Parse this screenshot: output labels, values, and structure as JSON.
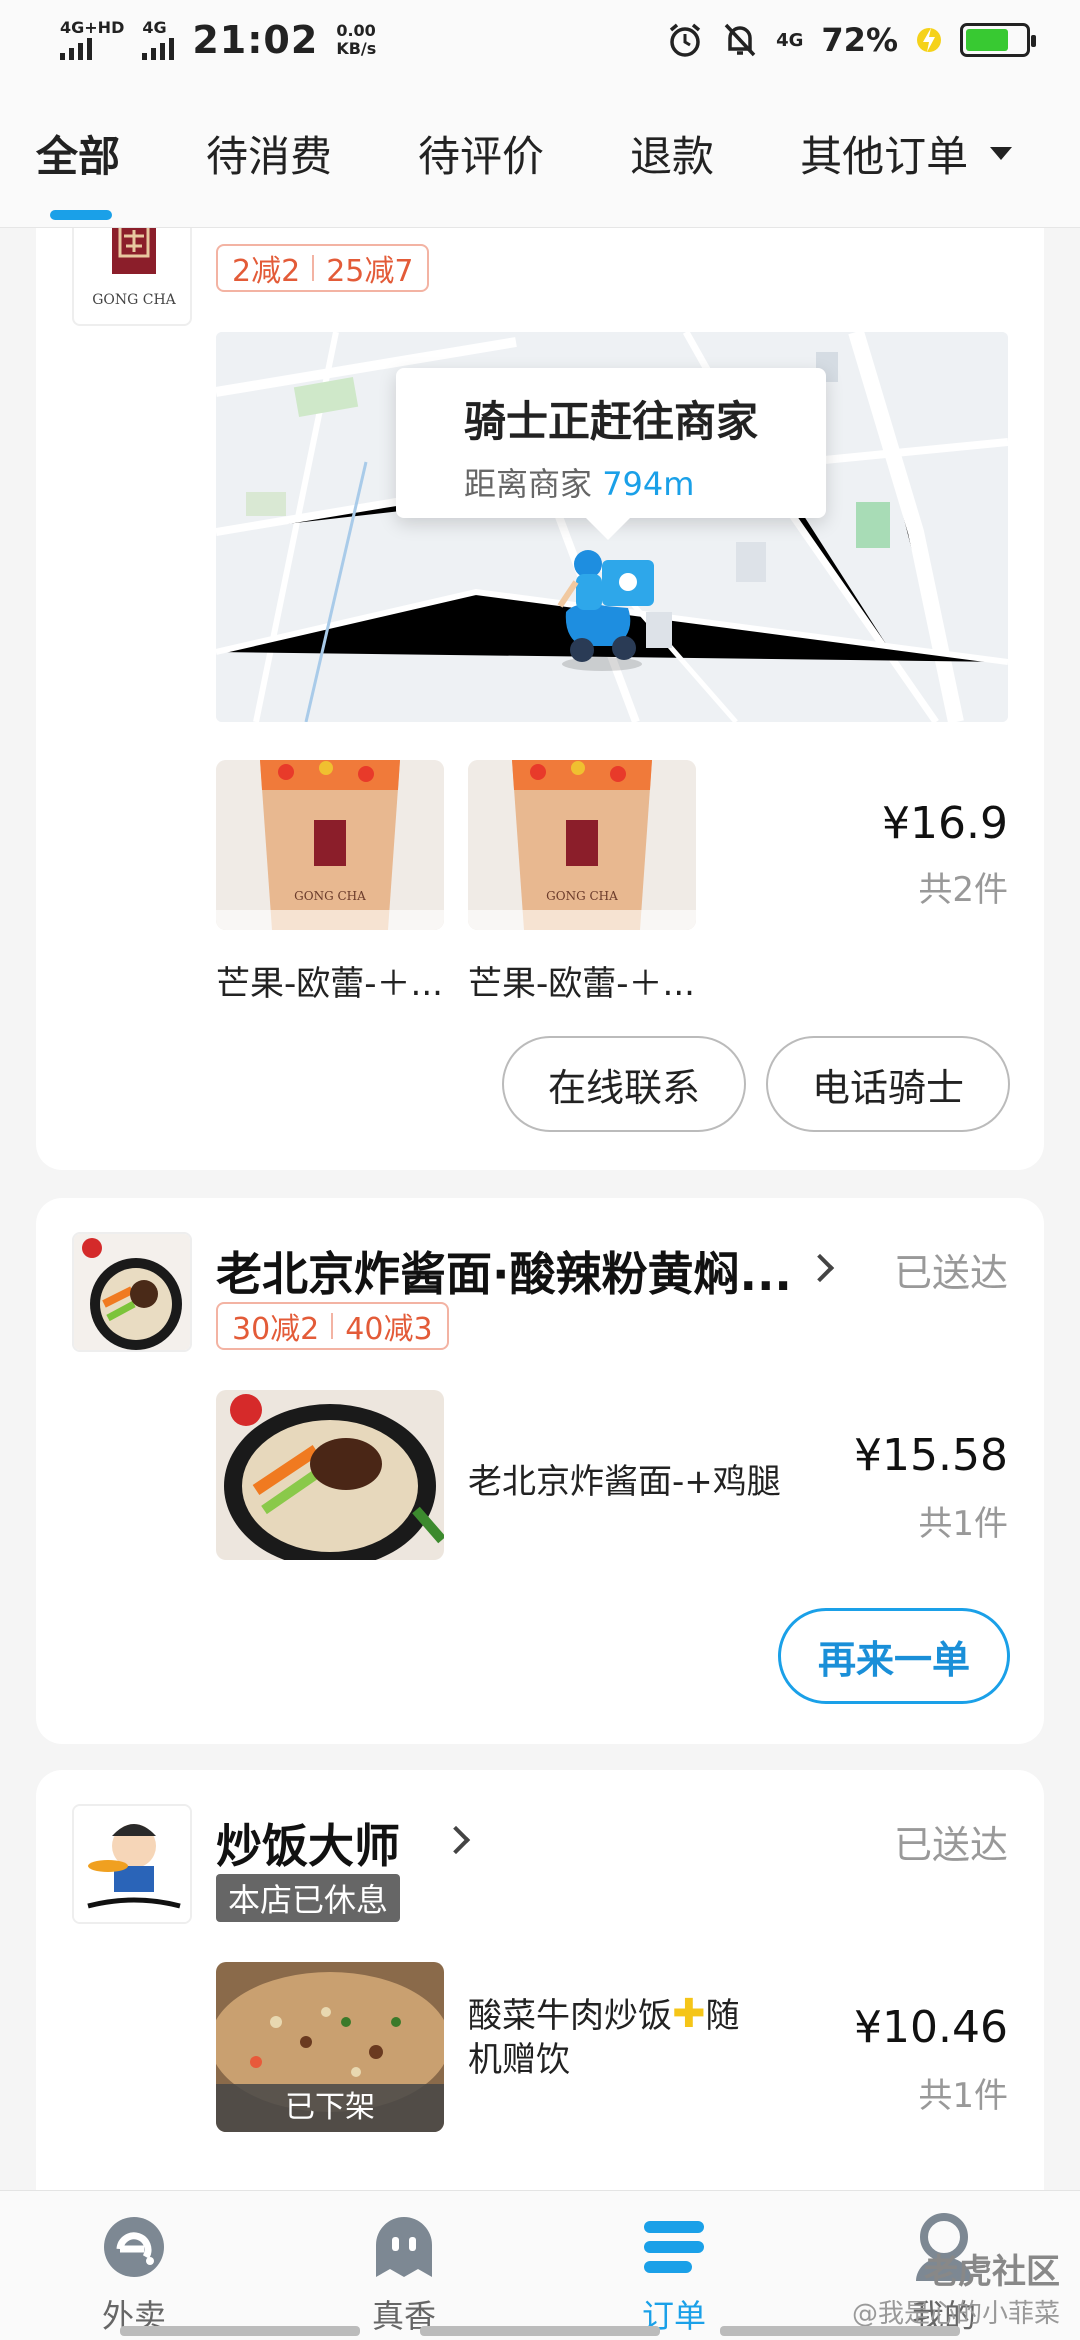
{
  "status_bar": {
    "network1": "4G+HD",
    "network2": "4G",
    "time": "21:02",
    "speed_value": "0.00",
    "speed_unit": "KB/s",
    "network3": "4G",
    "battery": "72%",
    "battery_level": 0.72
  },
  "tabs": [
    {
      "label": "全部",
      "active": true
    },
    {
      "label": "待消费"
    },
    {
      "label": "待评价"
    },
    {
      "label": "退款"
    },
    {
      "label": "其他订单"
    }
  ],
  "order1": {
    "logo_text": "GONG CHA",
    "promos": [
      "2减2",
      "25减7"
    ],
    "map": {
      "title": "骑士正赶往商家",
      "distance_label": "距离商家",
      "distance_value": "794m"
    },
    "items": [
      "芒果-欧蕾-＋...",
      "芒果-欧蕾-＋..."
    ],
    "thumb_label": "GONG CHA",
    "price": "¥16.9",
    "count": "共2件",
    "buttons": [
      "在线联系",
      "电话骑士"
    ]
  },
  "order2": {
    "shop_name": "老北京炸酱面·酸辣粉黄焖...",
    "status": "已送达",
    "promos": [
      "30减2",
      "40减3"
    ],
    "item_name": "老北京炸酱面-+鸡腿",
    "price": "¥15.58",
    "count": "共1件",
    "button": "再来一单"
  },
  "order3": {
    "shop_name": "炒饭大师",
    "status": "已送达",
    "badge": "本店已休息",
    "item_name_line1": "酸菜牛肉炒饭",
    "item_name_line2": "机赠饮",
    "item_name_tail": "随",
    "off_shelf": "已下架",
    "price": "¥10.46",
    "count": "共1件"
  },
  "bottom_nav": [
    {
      "label": "外卖",
      "icon": "eleme-icon"
    },
    {
      "label": "真香",
      "icon": "ghost-icon"
    },
    {
      "label": "订单",
      "icon": "order-list-icon",
      "active": true
    },
    {
      "label": "我的",
      "icon": "user-icon"
    }
  ],
  "watermark": {
    "line1": "老虎社区",
    "line2": "@我是心的小菲菜"
  },
  "colors": {
    "accent": "#1aa0e8",
    "promo": "#e35b38",
    "success": "#38c932"
  }
}
